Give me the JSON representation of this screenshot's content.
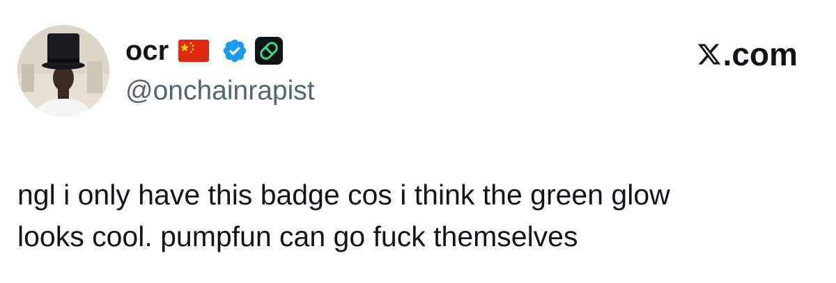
{
  "author": {
    "display_name": "ocr",
    "handle": "@onchainrapist",
    "badges": [
      "china-flag-icon",
      "verified-checkmark-icon",
      "green-pill-icon"
    ]
  },
  "brand": {
    "text": ".com",
    "icon": "x-logo-icon"
  },
  "tweet": {
    "text": "ngl i only have this badge cos i think the green glow\nlooks cool. pumpfun can go fuck themselves"
  },
  "colors": {
    "verified_blue": "#1d9bf0",
    "pill_green": "#3ddc84",
    "flag_red": "#de2910",
    "flag_yellow": "#ffde00",
    "handle_gray": "#536471"
  }
}
